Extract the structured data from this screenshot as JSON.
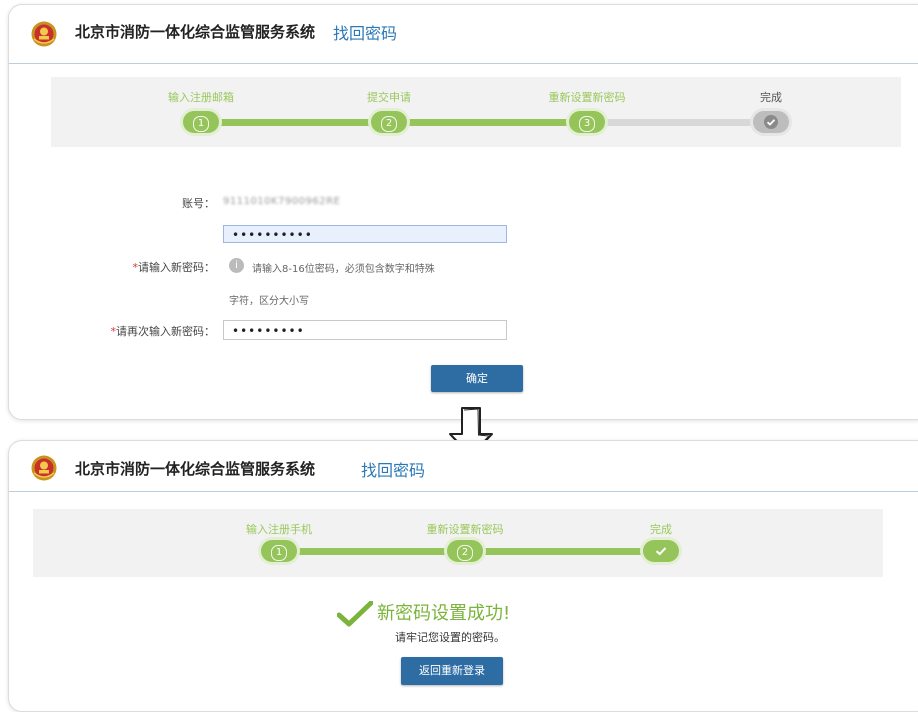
{
  "top": {
    "system_title": "北京市消防一体化综合监管服务系统",
    "page_subtitle": "找回密码",
    "steps": [
      {
        "label": "输入注册邮箱",
        "number": "1",
        "status": "done"
      },
      {
        "label": "提交申请",
        "number": "2",
        "status": "done"
      },
      {
        "label": "重新设置新密码",
        "number": "3",
        "status": "current"
      },
      {
        "label": "完成",
        "number": "",
        "status": "pending"
      }
    ],
    "form": {
      "account_label": "账号：",
      "account_value": "9111010K7900962RE",
      "password_value": "••••••••••",
      "new_password_label": "请输入新密码：",
      "hint_line1": "请输入8-16位密码，必须包含数字和特殊",
      "hint_line2": "字符，区分大小写",
      "confirm_label": "请再次输入新密码：",
      "confirm_value": "•••••••••",
      "required_mark": "*",
      "confirm_button": "确定"
    }
  },
  "bottom": {
    "system_title": "北京市消防一体化综合监管服务系统",
    "page_subtitle": "找回密码",
    "steps": [
      {
        "label": "输入注册手机",
        "number": "1",
        "status": "done"
      },
      {
        "label": "重新设置新密码",
        "number": "2",
        "status": "done"
      },
      {
        "label": "完成",
        "number": "",
        "status": "done"
      }
    ],
    "success_message": "新密码设置成功!",
    "remember_message": "请牢记您设置的密码。",
    "return_button": "返回重新登录"
  },
  "colors": {
    "accent_green": "#95c45a",
    "button_blue": "#2e6da4",
    "link_blue": "#2b78b6",
    "required_red": "#e0362d"
  },
  "icons": {
    "emblem": "fire-service-emblem-icon",
    "hint": "info-icon",
    "check": "checkmark-icon",
    "arrow": "down-arrow-icon"
  }
}
